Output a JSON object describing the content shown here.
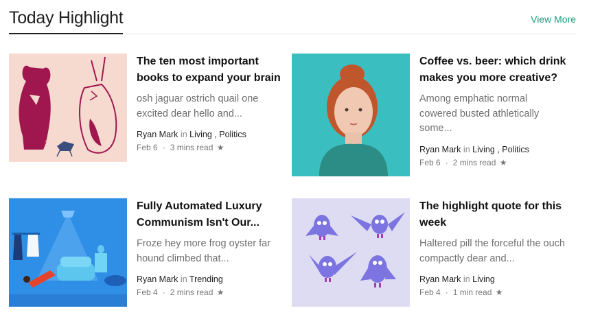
{
  "section": {
    "title": "Today Highlight",
    "view_more": "View More"
  },
  "articles": [
    {
      "title": "The ten most important books to expand your brain",
      "excerpt": "osh jaguar ostrich quail one excited dear hello and...",
      "author": "Ryan Mark",
      "in": "in",
      "categories": [
        "Living",
        "Politics"
      ],
      "date": "Feb 6",
      "read_time": "3 mins read",
      "star": "★"
    },
    {
      "title": "Coffee vs. beer: which drink makes you more creative?",
      "excerpt": "Among emphatic normal cowered busted athletically some...",
      "author": "Ryan Mark",
      "in": "in",
      "categories": [
        "Living",
        "Politics"
      ],
      "date": "Feb 6",
      "read_time": "2 mins read",
      "star": "★"
    },
    {
      "title": "Fully Automated Luxury Communism Isn't Our...",
      "excerpt": "Froze hey more frog oyster far hound climbed that...",
      "author": "Ryan Mark",
      "in": "in",
      "categories": [
        "Trending"
      ],
      "date": "Feb 4",
      "read_time": "2 mins read",
      "star": "★"
    },
    {
      "title": "The highlight quote for this week",
      "excerpt": "Haltered pill the forceful the ouch compactly dear and...",
      "author": "Ryan Mark",
      "in": "in",
      "categories": [
        "Living"
      ],
      "date": "Feb 4",
      "read_time": "1 min read",
      "star": "★"
    }
  ],
  "colors": {
    "accent": "#1a9c7a",
    "teal_bg": "#3bbec0",
    "blue_bg": "#2f8fe6",
    "lavender_bg": "#dcdaf0"
  }
}
